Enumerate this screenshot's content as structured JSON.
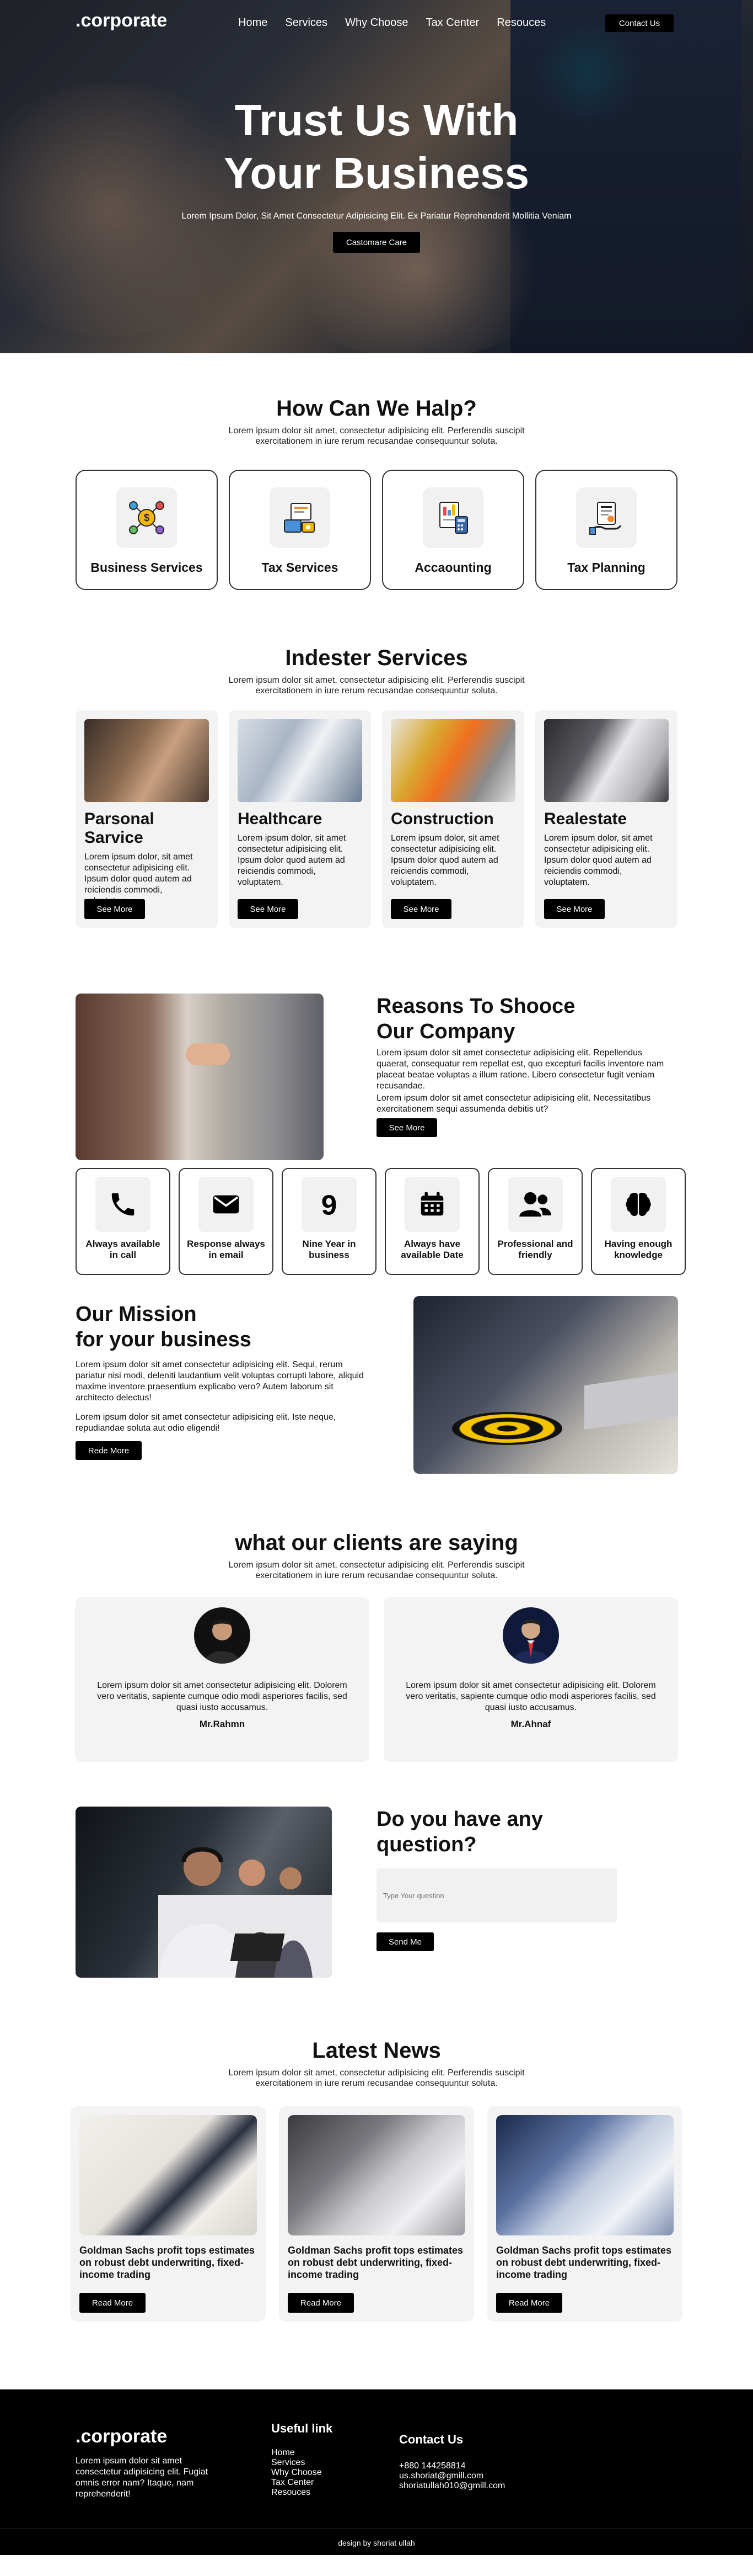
{
  "nav": {
    "logo": ".corporate",
    "items": [
      "Home",
      "Services",
      "Why Choose",
      "Tax Center",
      "Resouces"
    ],
    "contact_label": "Contact Us"
  },
  "hero": {
    "title_line1": "Trust Us With",
    "title_line2": "Your Business",
    "subtitle": "Lorem Ipsum Dolor, Sit Amet Consectetur Adipisicing Elit. Ex Pariatur Reprehenderit Mollitia Veniam",
    "button": "Castomare Care"
  },
  "help": {
    "title": "How Can We Halp?",
    "desc": "Lorem ipsum dolor sit amet, consectetur adipisicing elit. Perferendis suscipit exercitationem in iure rerum recusandae consequuntur soluta.",
    "cards": [
      {
        "label": "Business Services",
        "icon": "business-services-icon"
      },
      {
        "label": "Tax Services",
        "icon": "tax-services-icon"
      },
      {
        "label": "Accaounting",
        "icon": "accounting-icon"
      },
      {
        "label": "Tax Planning",
        "icon": "tax-planning-icon"
      }
    ]
  },
  "industry": {
    "title": "Indester Services",
    "desc": "Lorem ipsum dolor sit amet, consectetur adipisicing elit. Perferendis suscipit exercitationem in iure rerum recusandae consequuntur soluta.",
    "cards": [
      {
        "title": "Parsonal Sarvice",
        "text": "Lorem ipsum dolor, sit amet consectetur adipisicing elit. Ipsum dolor quod autem ad reiciendis commodi, voluptatem.",
        "button": "See More"
      },
      {
        "title": "Healthcare",
        "text": "Lorem ipsum dolor, sit amet consectetur adipisicing elit. Ipsum dolor quod autem ad reiciendis commodi, voluptatem.",
        "button": "See More"
      },
      {
        "title": "Construction",
        "text": "Lorem ipsum dolor, sit amet consectetur adipisicing elit. Ipsum dolor quod autem ad reiciendis commodi, voluptatem.",
        "button": "See More"
      },
      {
        "title": "Realestate",
        "text": "Lorem ipsum dolor, sit amet consectetur adipisicing elit. Ipsum dolor quod autem ad reiciendis commodi, voluptatem.",
        "button": "See More"
      }
    ]
  },
  "reasons": {
    "title_line1": "Reasons To Shooce",
    "title_line2": "Our Company",
    "p1": "Lorem ipsum dolor sit amet consectetur adipisicing elit. Repellendus quaerat, consequatur rem repellat est, quo excepturi facilis inventore nam placeat beatae voluptas a illum ratione. Libero consectetur fugit veniam recusandae.",
    "p2": "Lorem ipsum dolor sit amet consectetur adipisicing elit. Necessitatibus exercitationem sequi assumenda debitis ut?",
    "button": "See More",
    "features": [
      {
        "label": "Always available in call",
        "icon": "phone-icon"
      },
      {
        "label": "Response always in email",
        "icon": "envelope-icon"
      },
      {
        "label": "Nine Year in business",
        "icon": "number-nine-icon"
      },
      {
        "label": "Always have available Date",
        "icon": "calendar-icon"
      },
      {
        "label": "Professional and friendly",
        "icon": "users-icon"
      },
      {
        "label": "Having enough knowledge",
        "icon": "brain-icon"
      }
    ]
  },
  "mission": {
    "title_line1": "Our Mission",
    "title_line2": "for your business",
    "p1": "Lorem ipsum dolor sit amet consectetur adipisicing elit. Sequi, rerum pariatur nisi modi, deleniti laudantium velit voluptas corrupti labore, aliquid maxime inventore praesentium explicabo vero? Autem laborum sit architecto delectus!",
    "p2": "Lorem ipsum dolor sit amet consectetur adipisicing elit. Iste neque, repudiandae soluta aut odio eligendi!",
    "button": "Rede More"
  },
  "testimonials": {
    "title": "what our clients are saying",
    "desc": "Lorem ipsum dolor sit amet, consectetur adipisicing elit. Perferendis suscipit exercitationem in iure rerum recusandae consequuntur soluta.",
    "items": [
      {
        "text": "Lorem ipsum dolor sit amet consectetur adipisicing elit. Dolorem vero veritatis, sapiente cumque odio modi asperiores facilis, sed quasi iusto accusamus.",
        "name": "Mr.Rahmn"
      },
      {
        "text": "Lorem ipsum dolor sit amet consectetur adipisicing elit. Dolorem vero veritatis, sapiente cumque odio modi asperiores facilis, sed quasi iusto accusamus.",
        "name": "Mr.Ahnaf"
      }
    ]
  },
  "question": {
    "title_line1": "Do you have any",
    "title_line2": "question?",
    "placeholder": "Type Your question",
    "button": "Send Me"
  },
  "news": {
    "title": "Latest News",
    "desc": "Lorem ipsum dolor sit amet, consectetur adipisicing elit. Perferendis suscipit exercitationem in iure rerum recusandae consequuntur soluta.",
    "items": [
      {
        "title": "Goldman Sachs profit tops estimates on robust debt underwriting, fixed-income trading",
        "button": "Read More"
      },
      {
        "title": "Goldman Sachs profit tops estimates on robust debt underwriting, fixed-income trading",
        "button": "Read More"
      },
      {
        "title": "Goldman Sachs profit tops estimates on robust debt underwriting, fixed-income trading",
        "button": "Read More"
      }
    ]
  },
  "footer": {
    "logo": ".corporate",
    "desc": "Lorem ipsum dolor sit amet consectetur adipisicing elit. Fugiat omnis error nam? Itaque, nam reprehenderit!",
    "useful_title": "Useful link",
    "useful_links": [
      "Home",
      "Services",
      "Why Choose",
      "Tax Center",
      "Resouces"
    ],
    "contact_title": "Contact Us",
    "contact_lines": [
      "+880 144258814",
      "us.shoriat@gmill.com",
      "shoriatullah010@gmill.com"
    ],
    "credit": "design by shoriat ullah"
  }
}
